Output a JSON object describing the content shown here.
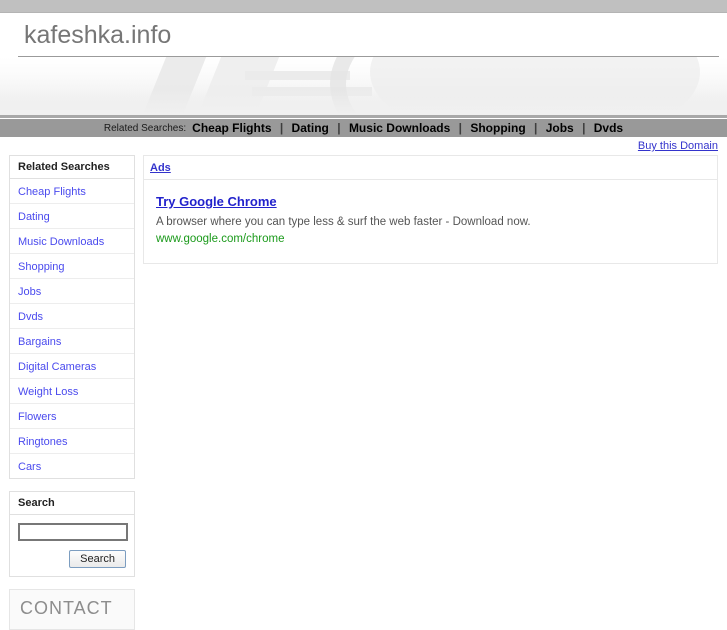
{
  "site": {
    "title": "kafeshka.info"
  },
  "related_bar": {
    "label": "Related Searches:",
    "separator": "|",
    "links": [
      "Cheap Flights",
      "Dating",
      "Music Downloads",
      "Shopping",
      "Jobs",
      "Dvds"
    ]
  },
  "buy": {
    "label": "Buy this Domain"
  },
  "sidebar": {
    "related": {
      "heading": "Related Searches",
      "items": [
        "Cheap Flights",
        "Dating",
        "Music Downloads",
        "Shopping",
        "Jobs",
        "Dvds",
        "Bargains",
        "Digital Cameras",
        "Weight Loss",
        "Flowers",
        "Ringtones",
        "Cars"
      ]
    },
    "search": {
      "heading": "Search",
      "input_value": "",
      "input_placeholder": "",
      "button_label": "Search"
    },
    "contact": {
      "heading": "CONTACT"
    }
  },
  "content": {
    "ads_label": "Ads",
    "ads": [
      {
        "title": "Try Google Chrome",
        "description": "A browser where you can type less & surf the web faster - Download now.",
        "url": "www.google.com/chrome"
      }
    ]
  },
  "colors": {
    "top_strip": "#c0c0c0",
    "rel_bar": "#999999",
    "link_blue": "#3333cc",
    "sidebar_link": "#4a4aee",
    "ad_url_green": "#1b9a1b",
    "title_gray": "#767676"
  }
}
